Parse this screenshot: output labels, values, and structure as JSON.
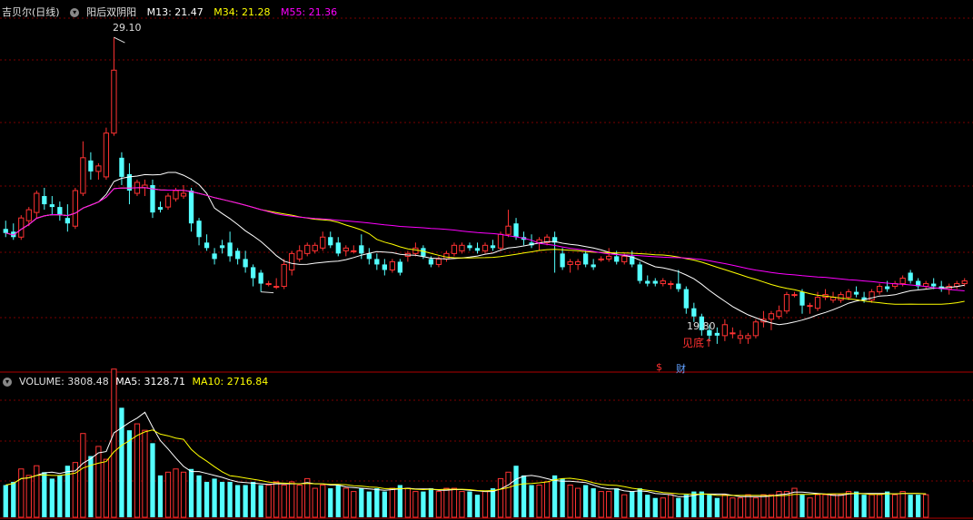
{
  "header": {
    "title": "吉贝尔(日线)",
    "indicator": "阳后双阴阳",
    "ma13_label": "M13: 21.47",
    "ma34_label": "M34: 21.28",
    "ma55_label": "M55: 21.36"
  },
  "volume_header": {
    "volume_label": "VOLUME: 3808.48",
    "ma5_label": "MA5: 3128.71",
    "ma10_label": "MA10: 2716.84"
  },
  "annotations": {
    "high_label": "29.10",
    "low_label": "19.80",
    "signal_label": "见底↑",
    "badge_money": "$",
    "badge_cai": "财"
  },
  "colors": {
    "up": "#ff3232",
    "down": "#54ffff",
    "ma13": "#ffffff",
    "ma34": "#ffff00",
    "ma55": "#ff00ff",
    "grid": "#7a0000",
    "divider": "#b00000"
  },
  "chart_data": [
    {
      "type": "candlestick",
      "title": "吉贝尔(日线)",
      "ylim": [
        17.2,
        29.8
      ],
      "series_names": [
        "M13",
        "M34",
        "M55"
      ],
      "candles": [
        [
          22.1,
          22.4,
          21.8,
          21.95
        ],
        [
          22.0,
          22.3,
          21.7,
          21.8
        ],
        [
          21.8,
          22.6,
          21.7,
          22.5
        ],
        [
          22.4,
          22.9,
          22.2,
          22.8
        ],
        [
          22.7,
          23.5,
          22.5,
          23.4
        ],
        [
          23.3,
          23.6,
          22.8,
          23.0
        ],
        [
          23.0,
          23.3,
          22.6,
          22.9
        ],
        [
          22.9,
          23.1,
          22.4,
          22.6
        ],
        [
          22.5,
          23.0,
          22.0,
          22.3
        ],
        [
          22.2,
          23.6,
          22.1,
          23.5
        ],
        [
          23.4,
          25.3,
          23.3,
          24.7
        ],
        [
          24.6,
          24.9,
          23.9,
          24.2
        ],
        [
          24.2,
          24.5,
          23.9,
          24.4
        ],
        [
          24.0,
          25.8,
          23.9,
          25.6
        ],
        [
          25.6,
          29.1,
          25.5,
          27.9
        ],
        [
          24.7,
          24.9,
          23.7,
          24.0
        ],
        [
          24.1,
          24.5,
          23.0,
          23.5
        ],
        [
          23.4,
          23.9,
          23.3,
          23.8
        ],
        [
          23.6,
          23.9,
          23.3,
          23.7
        ],
        [
          23.7,
          23.9,
          22.5,
          22.7
        ],
        [
          22.9,
          23.1,
          22.7,
          22.8
        ],
        [
          22.9,
          23.4,
          22.8,
          23.3
        ],
        [
          23.2,
          23.6,
          23.1,
          23.5
        ],
        [
          23.3,
          23.7,
          23.2,
          23.4
        ],
        [
          23.5,
          23.6,
          22.0,
          22.3
        ],
        [
          22.4,
          22.5,
          21.5,
          21.8
        ],
        [
          21.6,
          21.9,
          21.3,
          21.4
        ],
        [
          21.2,
          21.4,
          20.8,
          21.0
        ],
        [
          21.5,
          21.7,
          21.2,
          21.4
        ],
        [
          21.6,
          22.0,
          20.9,
          21.1
        ],
        [
          21.3,
          21.4,
          20.8,
          21.0
        ],
        [
          21.0,
          21.3,
          20.5,
          20.7
        ],
        [
          20.7,
          20.8,
          20.0,
          20.3
        ],
        [
          20.5,
          20.6,
          19.8,
          20.1
        ],
        [
          20.1,
          20.2,
          20.0,
          20.1
        ],
        [
          20.0,
          20.3,
          19.9,
          20.0
        ],
        [
          20.0,
          21.0,
          19.9,
          20.8
        ],
        [
          20.6,
          21.3,
          20.4,
          21.2
        ],
        [
          21.0,
          21.5,
          20.9,
          21.3
        ],
        [
          21.2,
          21.6,
          21.1,
          21.5
        ],
        [
          21.3,
          21.6,
          21.2,
          21.5
        ],
        [
          21.4,
          22.0,
          21.3,
          21.8
        ],
        [
          21.8,
          22.0,
          21.4,
          21.5
        ],
        [
          21.6,
          21.8,
          21.1,
          21.2
        ],
        [
          21.3,
          21.5,
          21.1,
          21.4
        ],
        [
          21.3,
          21.5,
          21.2,
          21.3
        ],
        [
          21.5,
          21.9,
          21.0,
          21.2
        ],
        [
          21.2,
          21.4,
          20.8,
          21.0
        ],
        [
          21.0,
          21.2,
          20.6,
          20.8
        ],
        [
          20.8,
          21.0,
          20.4,
          20.6
        ],
        [
          20.6,
          21.0,
          20.5,
          20.9
        ],
        [
          20.9,
          21.0,
          20.4,
          20.5
        ],
        [
          21.1,
          21.3,
          20.9,
          21.2
        ],
        [
          21.2,
          21.6,
          21.1,
          21.4
        ],
        [
          21.4,
          21.5,
          21.0,
          21.1
        ],
        [
          21.0,
          21.1,
          20.7,
          20.8
        ],
        [
          20.8,
          21.1,
          20.7,
          21.0
        ],
        [
          21.0,
          21.3,
          20.9,
          21.2
        ],
        [
          21.2,
          21.6,
          21.1,
          21.5
        ],
        [
          21.3,
          21.6,
          21.2,
          21.5
        ],
        [
          21.5,
          21.6,
          21.3,
          21.4
        ],
        [
          21.4,
          21.6,
          21.2,
          21.3
        ],
        [
          21.3,
          21.6,
          21.2,
          21.5
        ],
        [
          21.5,
          21.7,
          21.3,
          21.4
        ],
        [
          21.4,
          22.0,
          21.3,
          21.9
        ],
        [
          21.9,
          22.8,
          21.8,
          22.2
        ],
        [
          22.3,
          22.5,
          21.7,
          21.8
        ],
        [
          21.8,
          22.0,
          21.5,
          21.7
        ],
        [
          21.6,
          21.9,
          21.4,
          21.5
        ],
        [
          21.6,
          21.8,
          21.3,
          21.7
        ],
        [
          21.6,
          21.9,
          21.5,
          21.8
        ],
        [
          21.8,
          22.0,
          20.5,
          21.6
        ],
        [
          21.2,
          21.4,
          20.6,
          20.7
        ],
        [
          20.8,
          21.0,
          20.5,
          20.9
        ],
        [
          20.8,
          21.0,
          20.6,
          20.9
        ],
        [
          21.2,
          21.3,
          20.7,
          20.8
        ],
        [
          20.8,
          21.0,
          20.6,
          20.7
        ],
        [
          21.0,
          21.1,
          20.9,
          21.0
        ],
        [
          21.0,
          21.4,
          20.9,
          21.1
        ],
        [
          21.1,
          21.3,
          20.8,
          20.9
        ],
        [
          20.9,
          21.2,
          20.8,
          21.1
        ],
        [
          21.1,
          21.3,
          20.7,
          20.8
        ],
        [
          20.8,
          20.9,
          20.1,
          20.2
        ],
        [
          20.2,
          20.4,
          20.0,
          20.1
        ],
        [
          20.2,
          20.3,
          20.0,
          20.1
        ],
        [
          20.1,
          20.3,
          20.0,
          20.2
        ],
        [
          20.1,
          20.2,
          19.9,
          20.1
        ],
        [
          20.1,
          20.6,
          19.8,
          19.9
        ],
        [
          19.9,
          20.0,
          19.0,
          19.2
        ],
        [
          19.2,
          19.4,
          18.7,
          18.9
        ],
        [
          18.9,
          19.0,
          18.2,
          18.4
        ],
        [
          18.4,
          18.6,
          18.0,
          18.2
        ],
        [
          18.3,
          18.5,
          17.9,
          18.2
        ],
        [
          18.2,
          18.8,
          18.0,
          18.6
        ],
        [
          18.3,
          18.5,
          18.1,
          18.3
        ],
        [
          18.1,
          18.4,
          17.9,
          18.2
        ],
        [
          18.1,
          18.3,
          17.9,
          18.2
        ],
        [
          18.2,
          18.8,
          18.1,
          18.7
        ],
        [
          18.7,
          19.1,
          18.5,
          18.8
        ],
        [
          18.8,
          19.1,
          18.4,
          19.0
        ],
        [
          18.9,
          19.3,
          18.8,
          19.1
        ],
        [
          19.1,
          19.8,
          19.0,
          19.7
        ],
        [
          19.7,
          19.8,
          19.6,
          19.7
        ],
        [
          19.8,
          19.9,
          19.0,
          19.3
        ],
        [
          19.3,
          19.4,
          19.0,
          19.3
        ],
        [
          19.2,
          19.8,
          19.1,
          19.6
        ],
        [
          19.6,
          19.9,
          19.5,
          19.7
        ],
        [
          19.5,
          19.8,
          19.4,
          19.6
        ],
        [
          19.5,
          19.8,
          19.4,
          19.7
        ],
        [
          19.6,
          19.9,
          19.5,
          19.8
        ],
        [
          19.8,
          20.0,
          19.6,
          19.7
        ],
        [
          19.6,
          19.8,
          19.4,
          19.5
        ],
        [
          19.5,
          19.9,
          19.4,
          19.8
        ],
        [
          19.8,
          20.1,
          19.7,
          20.0
        ],
        [
          20.0,
          20.2,
          19.8,
          19.9
        ],
        [
          20.0,
          20.2,
          19.9,
          20.1
        ],
        [
          20.1,
          20.4,
          20.0,
          20.3
        ],
        [
          20.5,
          20.6,
          20.1,
          20.2
        ],
        [
          20.2,
          20.3,
          19.9,
          20.0
        ],
        [
          20.0,
          20.2,
          19.9,
          20.1
        ],
        [
          20.1,
          20.3,
          19.9,
          20.0
        ],
        [
          20.0,
          20.2,
          19.8,
          19.9
        ],
        [
          19.9,
          20.1,
          19.7,
          20.0
        ],
        [
          20.0,
          20.2,
          19.9,
          20.1
        ],
        [
          20.1,
          20.3,
          20.0,
          20.2
        ]
      ],
      "annotations": {
        "high": 29.1,
        "low": 19.8
      }
    },
    {
      "type": "bar",
      "title": "VOLUME",
      "ylim": [
        0,
        4000
      ],
      "series_names": [
        "VOLUME",
        "MA5",
        "MA10"
      ],
      "values": [
        1000,
        1100,
        1500,
        1300,
        1600,
        1400,
        1200,
        1300,
        1600,
        1700,
        2600,
        1900,
        2200,
        1800,
        4600,
        3400,
        2700,
        2900,
        2700,
        2300,
        1300,
        1400,
        1500,
        1400,
        1500,
        1300,
        1100,
        1200,
        1100,
        1100,
        1000,
        1000,
        1100,
        1000,
        1000,
        1100,
        1000,
        1100,
        1000,
        1200,
        900,
        1000,
        900,
        1000,
        900,
        800,
        900,
        800,
        900,
        800,
        900,
        1000,
        900,
        800,
        800,
        900,
        800,
        900,
        900,
        800,
        800,
        700,
        800,
        900,
        1200,
        1400,
        1600,
        1300,
        1000,
        1000,
        1100,
        1300,
        1200,
        1000,
        900,
        1000,
        900,
        800,
        800,
        900,
        700,
        800,
        900,
        700,
        600,
        600,
        700,
        600,
        700,
        800,
        800,
        700,
        600,
        700,
        600,
        600,
        700,
        600,
        700,
        700,
        800,
        800,
        900,
        700,
        600,
        700,
        700,
        700,
        700,
        800,
        800,
        700,
        700,
        700,
        800,
        700,
        800,
        700,
        700,
        700
      ]
    }
  ]
}
